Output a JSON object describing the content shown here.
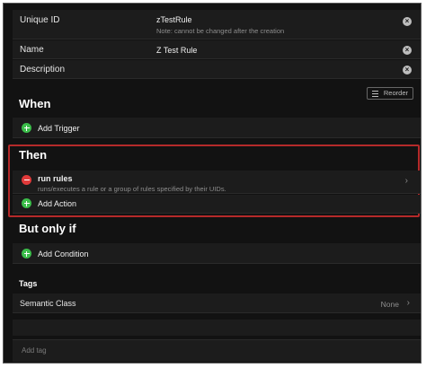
{
  "fields": {
    "uid": {
      "label": "Unique ID",
      "value": "zTestRule",
      "note": "Note: cannot be changed after the creation"
    },
    "name": {
      "label": "Name",
      "value": "Z Test Rule"
    },
    "description": {
      "label": "Description",
      "value": ""
    }
  },
  "reorder_label": "Reorder",
  "when": {
    "title": "When",
    "add_label": "Add Trigger"
  },
  "then": {
    "title": "Then",
    "action": {
      "title": "run rules",
      "description": "runs/executes a rule or a group of rules specified by their UIDs."
    },
    "add_label": "Add Action"
  },
  "but_only_if": {
    "title": "But only if",
    "add_label": "Add Condition"
  },
  "tags": {
    "title": "Tags",
    "semantic_class": {
      "label": "Semantic Class",
      "value": "None"
    },
    "add_tag_placeholder": "Add tag"
  },
  "icons": {
    "clear": "clear-circle-icon",
    "add": "plus-circle-icon",
    "remove": "minus-circle-icon",
    "chevron": "chevron-right-icon",
    "reorder": "reorder-lines-icon"
  },
  "colors": {
    "background": "#121212",
    "row": "#1c1c1c",
    "add_green": "#3bbd4a",
    "remove_red": "#e03a3a",
    "highlight": "#b52a2a"
  }
}
